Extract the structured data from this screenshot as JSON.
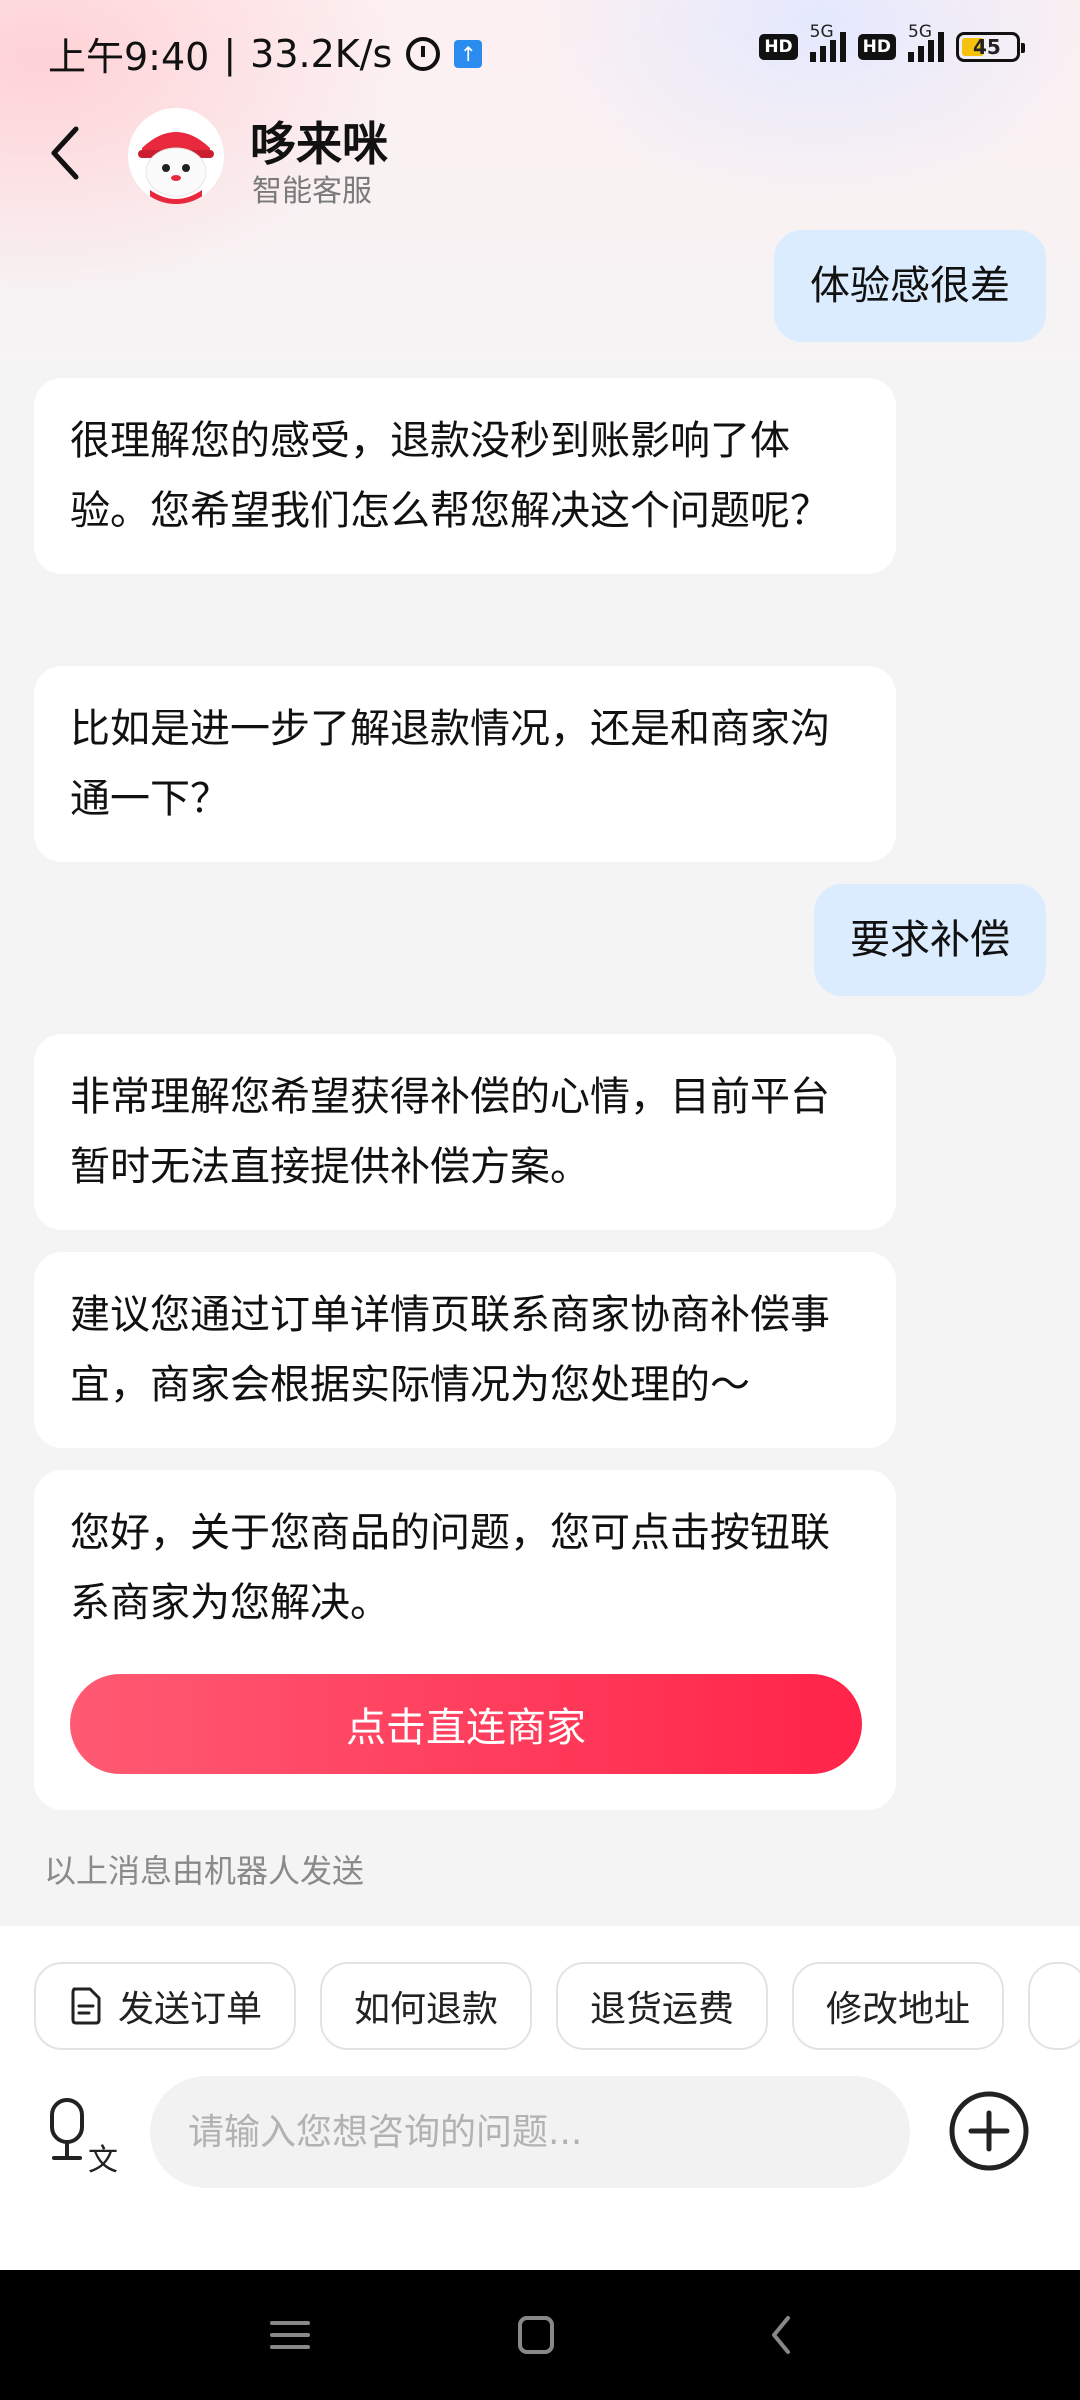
{
  "status_bar": {
    "time": "上午9:40",
    "speed": "33.2K/s",
    "hd1": "HD",
    "net1": "5G",
    "hd2": "HD",
    "net2": "5G",
    "battery": "45"
  },
  "header": {
    "title": "哆来咪",
    "subtitle": "智能客服"
  },
  "messages": {
    "user1": "体验感很差",
    "bot1": "很理解您的感受，退款没秒到账影响了体验。您希望我们怎么帮您解决这个问题呢？",
    "bot2": "比如是进一步了解退款情况，还是和商家沟通一下？",
    "user2": "要求补偿",
    "bot3": "非常理解您希望获得补偿的心情，目前平台暂时无法直接提供补偿方案。",
    "bot4": "建议您通过订单详情页联系商家协商补偿事宜，商家会根据实际情况为您处理的～",
    "bot5": "您好，关于您商品的问题，您可点击按钮联系商家为您解决。",
    "merchant_button": "点击直连商家"
  },
  "robot_note": "以上消息由机器人发送",
  "quick_actions": [
    "发送订单",
    "如何退款",
    "退货运费",
    "修改地址"
  ],
  "input": {
    "placeholder": "请输入您想咨询的问题..."
  },
  "colors": {
    "accent": "#ff2e55",
    "user_bubble": "#dcecff"
  }
}
